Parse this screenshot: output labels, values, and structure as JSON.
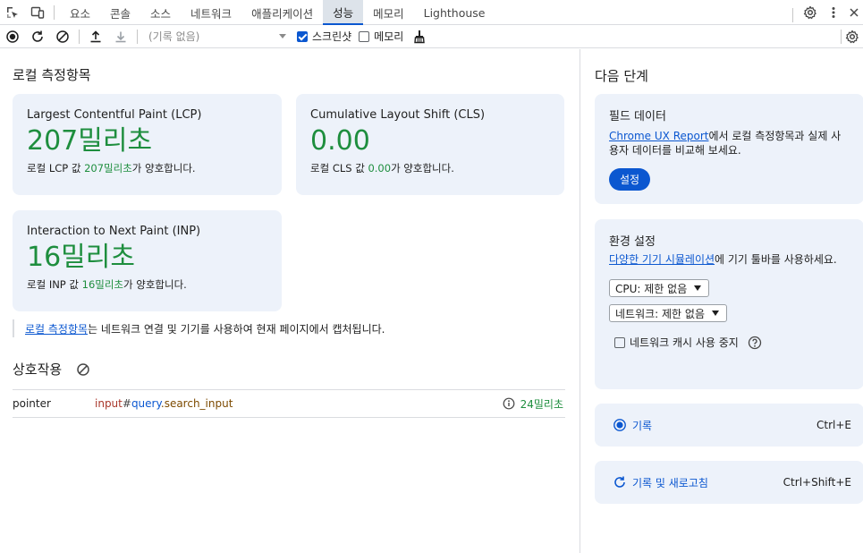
{
  "tabs": [
    {
      "label": "요소"
    },
    {
      "label": "콘솔"
    },
    {
      "label": "소스"
    },
    {
      "label": "네트워크"
    },
    {
      "label": "애플리케이션"
    },
    {
      "label": "성능",
      "active": true
    },
    {
      "label": "메모리"
    },
    {
      "label": "Lighthouse"
    }
  ],
  "toolbar": {
    "recording_placeholder": "(기록 없음)",
    "screenshot_label": "스크린샷",
    "screenshot_checked": true,
    "memory_label": "메모리",
    "memory_checked": false
  },
  "local_metrics": {
    "title": "로컬 측정항목",
    "lcp": {
      "name": "Largest Contentful Paint (LCP)",
      "value": "207밀리초",
      "desc_prefix": "로컬 LCP 값 ",
      "desc_value": "207밀리초",
      "desc_suffix": "가 양호합니다."
    },
    "cls": {
      "name": "Cumulative Layout Shift (CLS)",
      "value": "0.00",
      "desc_prefix": "로컬 CLS 값 ",
      "desc_value": "0.00",
      "desc_suffix": "가 양호합니다."
    },
    "inp": {
      "name": "Interaction to Next Paint (INP)",
      "value": "16밀리초",
      "desc_prefix": "로컬 INP 값 ",
      "desc_value": "16밀리초",
      "desc_suffix": "가 양호합니다."
    },
    "note_link": "로컬 측정항목",
    "note_text": "는 네트워크 연결 및 기기를 사용하여 현재 페이지에서 캡처됩니다."
  },
  "interactions": {
    "title": "상호작용",
    "rows": [
      {
        "type": "pointer",
        "sel_tag": "input",
        "sel_hash": "#",
        "sel_id": "query",
        "sel_cls": ".search_input",
        "duration": "24밀리초"
      }
    ]
  },
  "next_steps": {
    "title": "다음 단계",
    "field_data": {
      "heading": "필드 데이터",
      "link": "Chrome UX Report",
      "text": "에서 로컬 측정항목과 실제 사용자 데이터를 비교해 보세요.",
      "button": "설정"
    },
    "env": {
      "heading": "환경 설정",
      "link": "다양한 기기 시뮬레이션",
      "text": "에 기기 툴바를 사용하세요.",
      "cpu": "CPU: 제한 없음",
      "network": "네트워크: 제한 없음",
      "disable_cache": "네트워크 캐시 사용 중지",
      "disable_cache_checked": false
    },
    "record": {
      "label": "기록",
      "shortcut": "Ctrl+E"
    },
    "reload": {
      "label": "기록 및 새로고침",
      "shortcut": "Ctrl+Shift+E"
    }
  }
}
